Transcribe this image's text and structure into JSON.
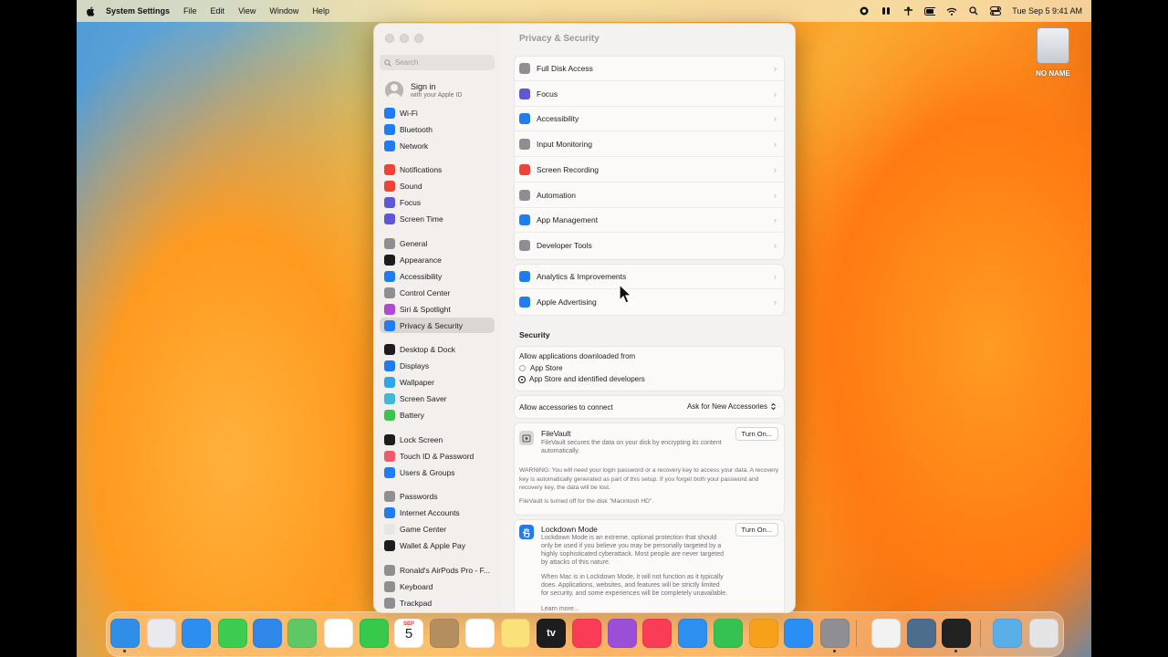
{
  "menubar": {
    "app_name": "System Settings",
    "menus": [
      "File",
      "Edit",
      "View",
      "Window",
      "Help"
    ],
    "clock": "Tue Sep 5  9:41 AM"
  },
  "desktop": {
    "disk_label": "NO NAME"
  },
  "window": {
    "title": "Privacy & Security",
    "search_placeholder": "Search",
    "signin": {
      "title": "Sign in",
      "subtitle": "with your Apple ID"
    },
    "sidebar": [
      {
        "label": "Wi-Fi",
        "icon": "wifi-icon",
        "color": "#1f7cf2"
      },
      {
        "label": "Bluetooth",
        "icon": "bluetooth-icon",
        "color": "#1f7cf2"
      },
      {
        "label": "Network",
        "icon": "globe-icon",
        "color": "#1f7cf2"
      },
      {
        "label": "Notifications",
        "icon": "bell-icon",
        "color": "#ee4336"
      },
      {
        "label": "Sound",
        "icon": "speaker-icon",
        "color": "#ee4336"
      },
      {
        "label": "Focus",
        "icon": "moon-icon",
        "color": "#5e57d6"
      },
      {
        "label": "Screen Time",
        "icon": "hourglass-icon",
        "color": "#5e57d6"
      },
      {
        "label": "General",
        "icon": "gear-icon",
        "color": "#8e8e93"
      },
      {
        "label": "Appearance",
        "icon": "appearance-icon",
        "color": "#1d1d1f"
      },
      {
        "label": "Accessibility",
        "icon": "accessibility-icon",
        "color": "#1f7cf2"
      },
      {
        "label": "Control Center",
        "icon": "control-center-icon",
        "color": "#8e8e93"
      },
      {
        "label": "Siri & Spotlight",
        "icon": "siri-icon",
        "color": "#b04ad1"
      },
      {
        "label": "Privacy & Security",
        "icon": "hand-icon",
        "color": "#1f7cf2"
      },
      {
        "label": "Desktop & Dock",
        "icon": "dock-icon",
        "color": "#1d1d1f"
      },
      {
        "label": "Displays",
        "icon": "sun-icon",
        "color": "#1f7cf2"
      },
      {
        "label": "Wallpaper",
        "icon": "wallpaper-icon",
        "color": "#2ea7e8"
      },
      {
        "label": "Screen Saver",
        "icon": "screensaver-icon",
        "color": "#3fb8d9"
      },
      {
        "label": "Battery",
        "icon": "battery-icon",
        "color": "#3cc34e"
      },
      {
        "label": "Lock Screen",
        "icon": "lock-icon",
        "color": "#1d1d1f"
      },
      {
        "label": "Touch ID & Password",
        "icon": "fingerprint-icon",
        "color": "#ee5a6a"
      },
      {
        "label": "Users & Groups",
        "icon": "users-icon",
        "color": "#1f7cf2"
      },
      {
        "label": "Passwords",
        "icon": "key-icon",
        "color": "#8e8e93"
      },
      {
        "label": "Internet Accounts",
        "icon": "at-icon",
        "color": "#1f7cf2"
      },
      {
        "label": "Game Center",
        "icon": "game-center-icon",
        "color": "#e8e5e2"
      },
      {
        "label": "Wallet & Apple Pay",
        "icon": "wallet-icon",
        "color": "#1d1d1f"
      },
      {
        "label": "Ronald's AirPods Pro - F...",
        "icon": "airpods-icon",
        "color": "#8e8e93"
      },
      {
        "label": "Keyboard",
        "icon": "keyboard-icon",
        "color": "#8e8e93"
      },
      {
        "label": "Trackpad",
        "icon": "trackpad-icon",
        "color": "#8e8e93"
      }
    ],
    "privacy_rows": [
      {
        "label": "Full Disk Access",
        "icon": "folder-icon",
        "color": "#8e8e93"
      },
      {
        "label": "Focus",
        "icon": "moon-icon",
        "color": "#5e57d6"
      },
      {
        "label": "Accessibility",
        "icon": "accessibility-icon",
        "color": "#1f7cf2"
      },
      {
        "label": "Input Monitoring",
        "icon": "keyboard-icon",
        "color": "#8e8e93"
      },
      {
        "label": "Screen Recording",
        "icon": "record-icon",
        "color": "#ee4336"
      },
      {
        "label": "Automation",
        "icon": "gear-icon",
        "color": "#8e8e93"
      },
      {
        "label": "App Management",
        "icon": "app-store-icon",
        "color": "#1f7cf2"
      },
      {
        "label": "Developer Tools",
        "icon": "hammer-icon",
        "color": "#8e8e93"
      }
    ],
    "analytics_rows": [
      {
        "label": "Analytics & Improvements",
        "icon": "chart-icon",
        "color": "#1f7cf2"
      },
      {
        "label": "Apple Advertising",
        "icon": "megaphone-icon",
        "color": "#1f7cf2"
      }
    ],
    "security": {
      "heading": "Security",
      "allow_apps_label": "Allow applications downloaded from",
      "options": [
        "App Store",
        "App Store and identified developers"
      ],
      "accessories_label": "Allow accessories to connect",
      "accessories_value": "Ask for New Accessories",
      "filevault": {
        "title": "FileVault",
        "desc": "FileVault secures the data on your disk by encrypting its content automatically.",
        "button": "Turn On...",
        "warning": "WARNING: You will need your login password or a recovery key to access your data. A recovery key is automatically generated as part of this setup. If you forget both your password and recovery key, the data will be lost.",
        "status": "FileVault is turned off for the disk \"Macintosh HD\"."
      },
      "lockdown": {
        "title": "Lockdown Mode",
        "desc": "Lockdown Mode is an extreme, optional protection that should only be used if you believe you may be personally targeted by a highly sophisticated cyberattack. Most people are never targeted by attacks of this nature.",
        "desc2": "When Mac is in Lockdown Mode, it will not function as it typically does. Applications, websites, and features will be strictly limited for security, and some experiences will be completely unavailable.",
        "learn_more": "Learn more...",
        "button": "Turn On..."
      }
    }
  },
  "dock": {
    "calendar_month": "SEP",
    "calendar_day": "5",
    "tv_label": "tv",
    "apps": [
      {
        "name": "finder-icon",
        "color": "#2f8fe8"
      },
      {
        "name": "launchpad-icon",
        "color": "#e9e9ee"
      },
      {
        "name": "safari-icon",
        "color": "#2b8ef0"
      },
      {
        "name": "messages-icon",
        "color": "#3ccc4f"
      },
      {
        "name": "mail-icon",
        "color": "#2f87ea"
      },
      {
        "name": "maps-icon",
        "color": "#5fc865"
      },
      {
        "name": "photos-icon",
        "color": "#ffffff"
      },
      {
        "name": "facetime-icon",
        "color": "#36c94b"
      },
      {
        "name": "calendar-icon",
        "color": "#ffffff"
      },
      {
        "name": "contacts-icon",
        "color": "#b58e60"
      },
      {
        "name": "reminders-icon",
        "color": "#ffffff"
      },
      {
        "name": "notes-icon",
        "color": "#fbe17a"
      },
      {
        "name": "tv-icon",
        "color": "#1d1d1f"
      },
      {
        "name": "music-icon",
        "color": "#fa3c56"
      },
      {
        "name": "podcasts-icon",
        "color": "#9b4fd6"
      },
      {
        "name": "news-icon",
        "color": "#fa3c56"
      },
      {
        "name": "keynote-icon",
        "color": "#2d8ff0"
      },
      {
        "name": "numbers-icon",
        "color": "#35c251"
      },
      {
        "name": "pages-icon",
        "color": "#f7a11b"
      },
      {
        "name": "app-store-icon",
        "color": "#2a8ef5"
      },
      {
        "name": "system-settings-icon",
        "color": "#8e8e93"
      },
      {
        "name": "textedit-icon",
        "color": "#f2f2f2"
      },
      {
        "name": "quicktime-icon",
        "color": "#4d6d8c"
      },
      {
        "name": "piano-icon",
        "color": "#222222"
      },
      {
        "name": "downloads-icon",
        "color": "#5aaee8"
      },
      {
        "name": "trash-icon",
        "color": "#e4e4e4"
      }
    ]
  }
}
